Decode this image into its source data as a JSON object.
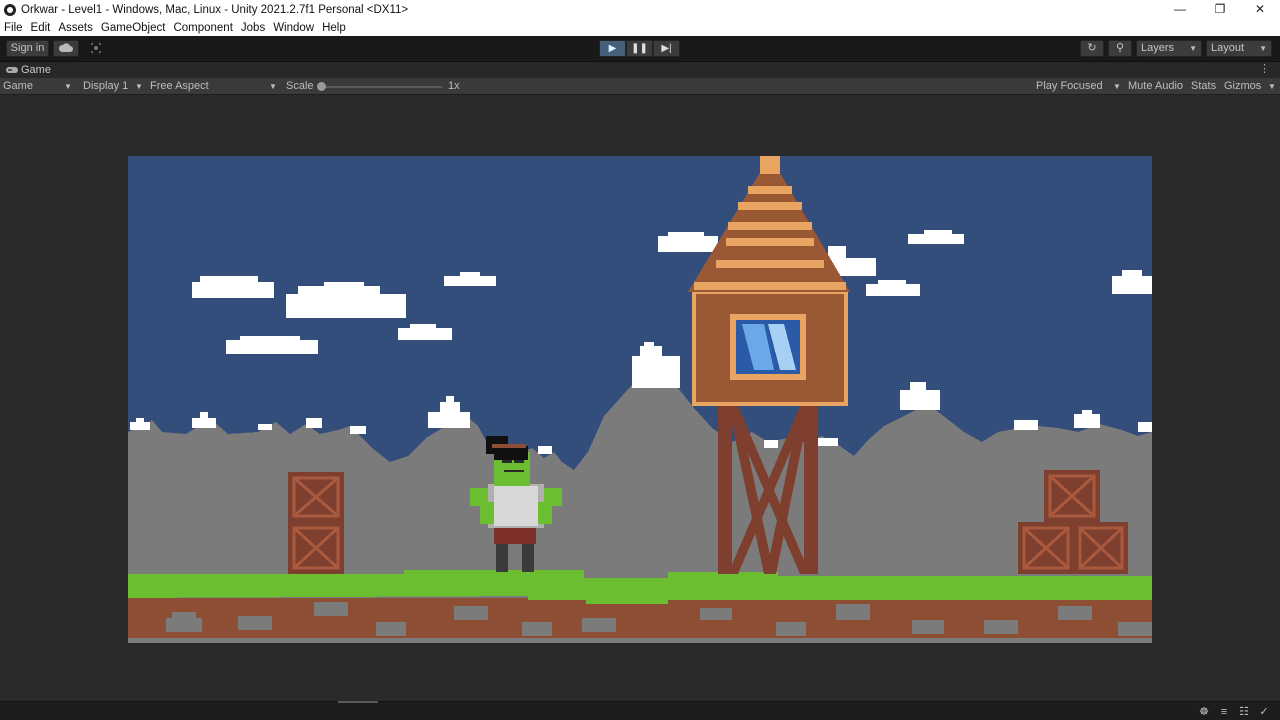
{
  "window": {
    "title": "Orkwar - Level1 - Windows, Mac, Linux - Unity 2021.2.7f1 Personal <DX11>",
    "minimize_icon": "minimize-icon",
    "maximize_icon": "restore-icon",
    "close_icon": "close-icon"
  },
  "menu": [
    "File",
    "Edit",
    "Assets",
    "GameObject",
    "Component",
    "Jobs",
    "Window",
    "Help"
  ],
  "toolbar": {
    "sign_in": "Sign in",
    "cloud_icon": "cloud-icon",
    "collab_icon": "collab-icon",
    "play_icon": "play-icon",
    "pause_icon": "pause-icon",
    "step_icon": "step-icon",
    "history_icon": "history-icon",
    "search_icon": "search-icon",
    "layers": "Layers",
    "layout": "Layout"
  },
  "tab": {
    "label": "Game"
  },
  "gamebar": {
    "view_select": "Game",
    "display": "Display 1",
    "aspect": "Free Aspect",
    "scale_label": "Scale",
    "scale_value": "1x",
    "play_focused": "Play Focused",
    "mute_audio": "Mute Audio",
    "stats": "Stats",
    "gizmos": "Gizmos"
  },
  "colors": {
    "sky": "#334e7a",
    "mountain": "#7b7b7b",
    "grass": "#6abe30",
    "dirt": "#8c4f33",
    "crate": "#7e3f2f",
    "tower": "#9a5834"
  },
  "status_icons": [
    "bug-icon",
    "layers-stack-icon",
    "network-icon",
    "check-circle-icon"
  ]
}
